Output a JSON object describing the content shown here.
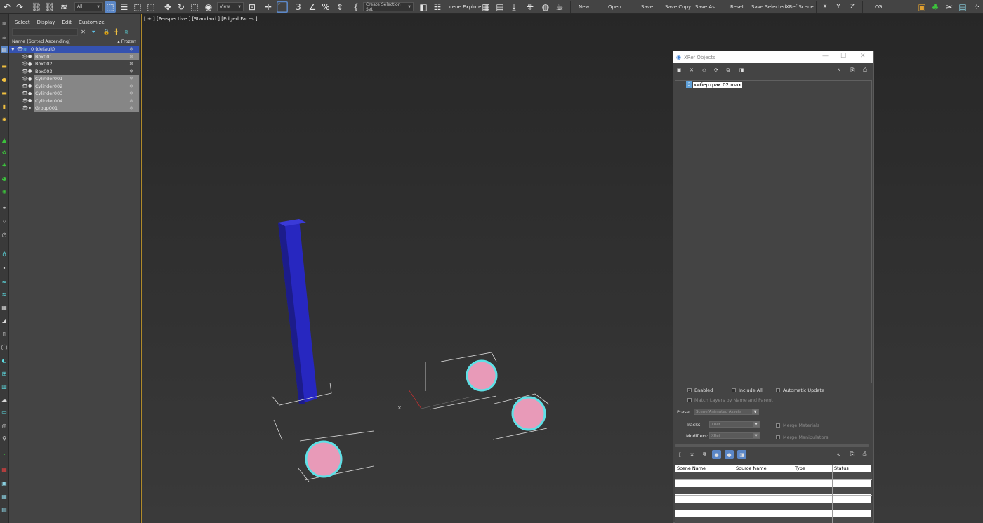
{
  "toolbar": {
    "selection_filter": "All",
    "ref_coord": "View",
    "named_selection": "Create Selection Set",
    "scene_explorer": "cene Explorer.",
    "buttons": [
      "New...",
      "Open...",
      "Save",
      "Save Copy",
      "Save As...",
      "Reset",
      "Save Selected",
      "XRef Scene..."
    ],
    "axes": [
      "X",
      "Y",
      "Z"
    ],
    "cg_label": "CG"
  },
  "explorer": {
    "menu": [
      "Select",
      "Display",
      "Edit",
      "Customize"
    ],
    "column_name": "Name (Sorted Ascending)",
    "column_frozen": "▴ Frozen",
    "rows": [
      {
        "name": "0 (default)"
      },
      {
        "name": "Box001"
      },
      {
        "name": "Box002"
      },
      {
        "name": "Box003"
      },
      {
        "name": "Cylinder001"
      },
      {
        "name": "Cylinder002"
      },
      {
        "name": "Cylinder003"
      },
      {
        "name": "Cylinder004"
      },
      {
        "name": "Group001"
      }
    ]
  },
  "viewport": {
    "label": "[ + ] [Perspective ] [Standard ] [Edged Faces ]"
  },
  "xref": {
    "title": "XRef Objects",
    "file": "кибертрак 02.max",
    "enabled": "Enabled",
    "include_all": "Include All",
    "automatic_update": "Automatic Update",
    "match_layers": "Match Layers by Name and Parent",
    "preset_label": "Preset:",
    "preset_value": "Scene/Animated Assets",
    "tracks_label": "Tracks:",
    "tracks_value": "XRef",
    "modifiers_label": "Modifiers:",
    "modifiers_value": "XRef",
    "merge_materials": "Merge Materials",
    "merge_manipulators": "Merge Manipulators",
    "table_headers": [
      "Scene Name",
      "Source Name",
      "Type",
      "Status"
    ]
  },
  "colors": {
    "selection_blue": "#5b87c7",
    "layer_row": "#3552b0",
    "box_blue": "#2323b4",
    "cylinder_pink": "#e89ab8",
    "cylinder_outline": "#5ee0e6"
  }
}
